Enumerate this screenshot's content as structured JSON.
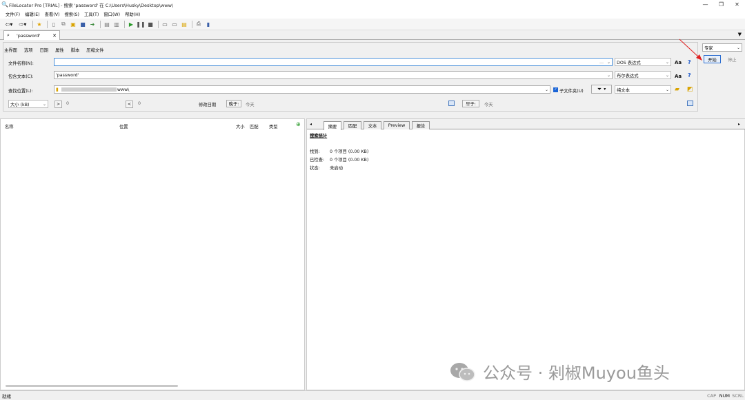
{
  "window": {
    "title": "FileLocator Pro [TRIAL] - 搜索 'password' 在 C:\\Users\\Husky\\Desktop\\www\\"
  },
  "menu": [
    "文件(F)",
    "编辑(E)",
    "查看(V)",
    "搜索(S)",
    "工具(T)",
    "窗口(W)",
    "帮助(H)"
  ],
  "search_tab": {
    "label": "'password'"
  },
  "subtabs": [
    "主界面",
    "选项",
    "日期",
    "属性",
    "脚本",
    "压缩文件"
  ],
  "criteria": {
    "filename_label": "文件名称(N):",
    "filename_value": "",
    "filename_mode": "DOS 表达式",
    "contains_label": "包含文本(C):",
    "contains_value": "'password'",
    "contains_mode": "布尔表达式",
    "lookin_label": "查找位置(L):",
    "lookin_value": "www\\",
    "subfolders_label": "子文件夹(U)",
    "text_mode": "纯文本",
    "size_unit": "大小 (kB)",
    "size_gt_op": ">",
    "size_gt_value": "0",
    "size_lt_op": "<",
    "size_lt_value": "0",
    "mdate_label": "修改日期",
    "later_label": "晚于:",
    "later_value": "今天",
    "earlier_label": "早于:",
    "earlier_value": "今天",
    "aa": "Aa",
    "help": "?"
  },
  "mode_combo": "专家",
  "buttons": {
    "start": "开始",
    "stop": "停止"
  },
  "results": {
    "col_name": "名称",
    "col_location": "位置",
    "col_size": "大小",
    "col_match": "匹配",
    "col_type": "类型"
  },
  "right_tabs": [
    "摘要",
    "匹配",
    "文本",
    "Preview",
    "报告"
  ],
  "summary": {
    "title": "搜索统计",
    "found_label": "找到:",
    "found_value": "0 个项目 (0.00 KB)",
    "checked_label": "已检查:",
    "checked_value": "0 个项目 (0.00 KB)",
    "state_label": "状态:",
    "state_value": "未启动"
  },
  "status": {
    "text": "就绪",
    "cap": "CAP",
    "num": "NUM",
    "scrl": "SCRL"
  },
  "watermark": "公众号 · 剁椒Muyou鱼头"
}
